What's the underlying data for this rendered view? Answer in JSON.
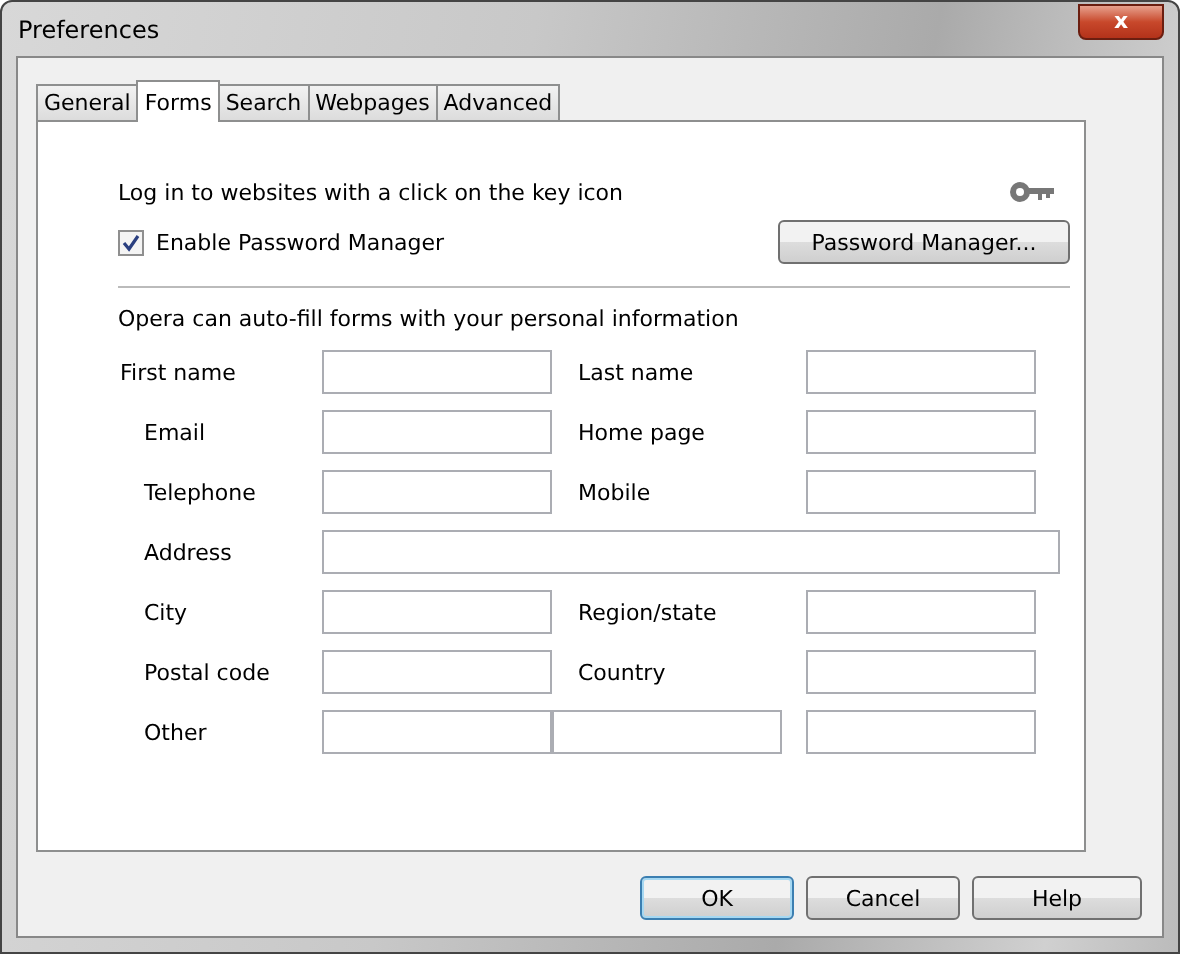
{
  "window": {
    "title": "Preferences",
    "close": "x"
  },
  "tabs": [
    {
      "label": "General",
      "selected": false
    },
    {
      "label": "Forms",
      "selected": true
    },
    {
      "label": "Search",
      "selected": false
    },
    {
      "label": "Webpages",
      "selected": false
    },
    {
      "label": "Advanced",
      "selected": false
    }
  ],
  "login_text": "Log in to websites with a click on the key icon",
  "enable_password_manager": {
    "label": "Enable Password Manager",
    "checked": true
  },
  "password_manager_button": "Password Manager...",
  "autofill_text": "Opera can auto-fill forms with your personal information",
  "rows": [
    [
      {
        "kind": "label",
        "text": "First name"
      },
      {
        "kind": "field"
      },
      {
        "kind": "label",
        "text": "Last name"
      },
      {
        "kind": "field"
      }
    ],
    [
      {
        "kind": "label",
        "text": "Email"
      },
      {
        "kind": "field"
      },
      {
        "kind": "label",
        "text": "Home page"
      },
      {
        "kind": "field"
      }
    ],
    [
      {
        "kind": "label",
        "text": "Telephone"
      },
      {
        "kind": "field"
      },
      {
        "kind": "label",
        "text": "Mobile"
      },
      {
        "kind": "field"
      }
    ],
    [
      {
        "kind": "label",
        "text": "Address"
      },
      {
        "kind": "wide-field"
      }
    ],
    [
      {
        "kind": "label",
        "text": "City"
      },
      {
        "kind": "field"
      },
      {
        "kind": "label",
        "text": "Region/state"
      },
      {
        "kind": "field"
      }
    ],
    [
      {
        "kind": "label",
        "text": "Postal code"
      },
      {
        "kind": "field"
      },
      {
        "kind": "label",
        "text": "Country"
      },
      {
        "kind": "field"
      }
    ],
    [
      {
        "kind": "label",
        "text": "Other"
      },
      {
        "kind": "field"
      },
      {
        "kind": "field"
      },
      {
        "kind": "field"
      }
    ]
  ],
  "buttons": [
    {
      "label": "OK",
      "default": true
    },
    {
      "label": "Cancel",
      "default": false
    },
    {
      "label": "Help",
      "default": false
    }
  ]
}
